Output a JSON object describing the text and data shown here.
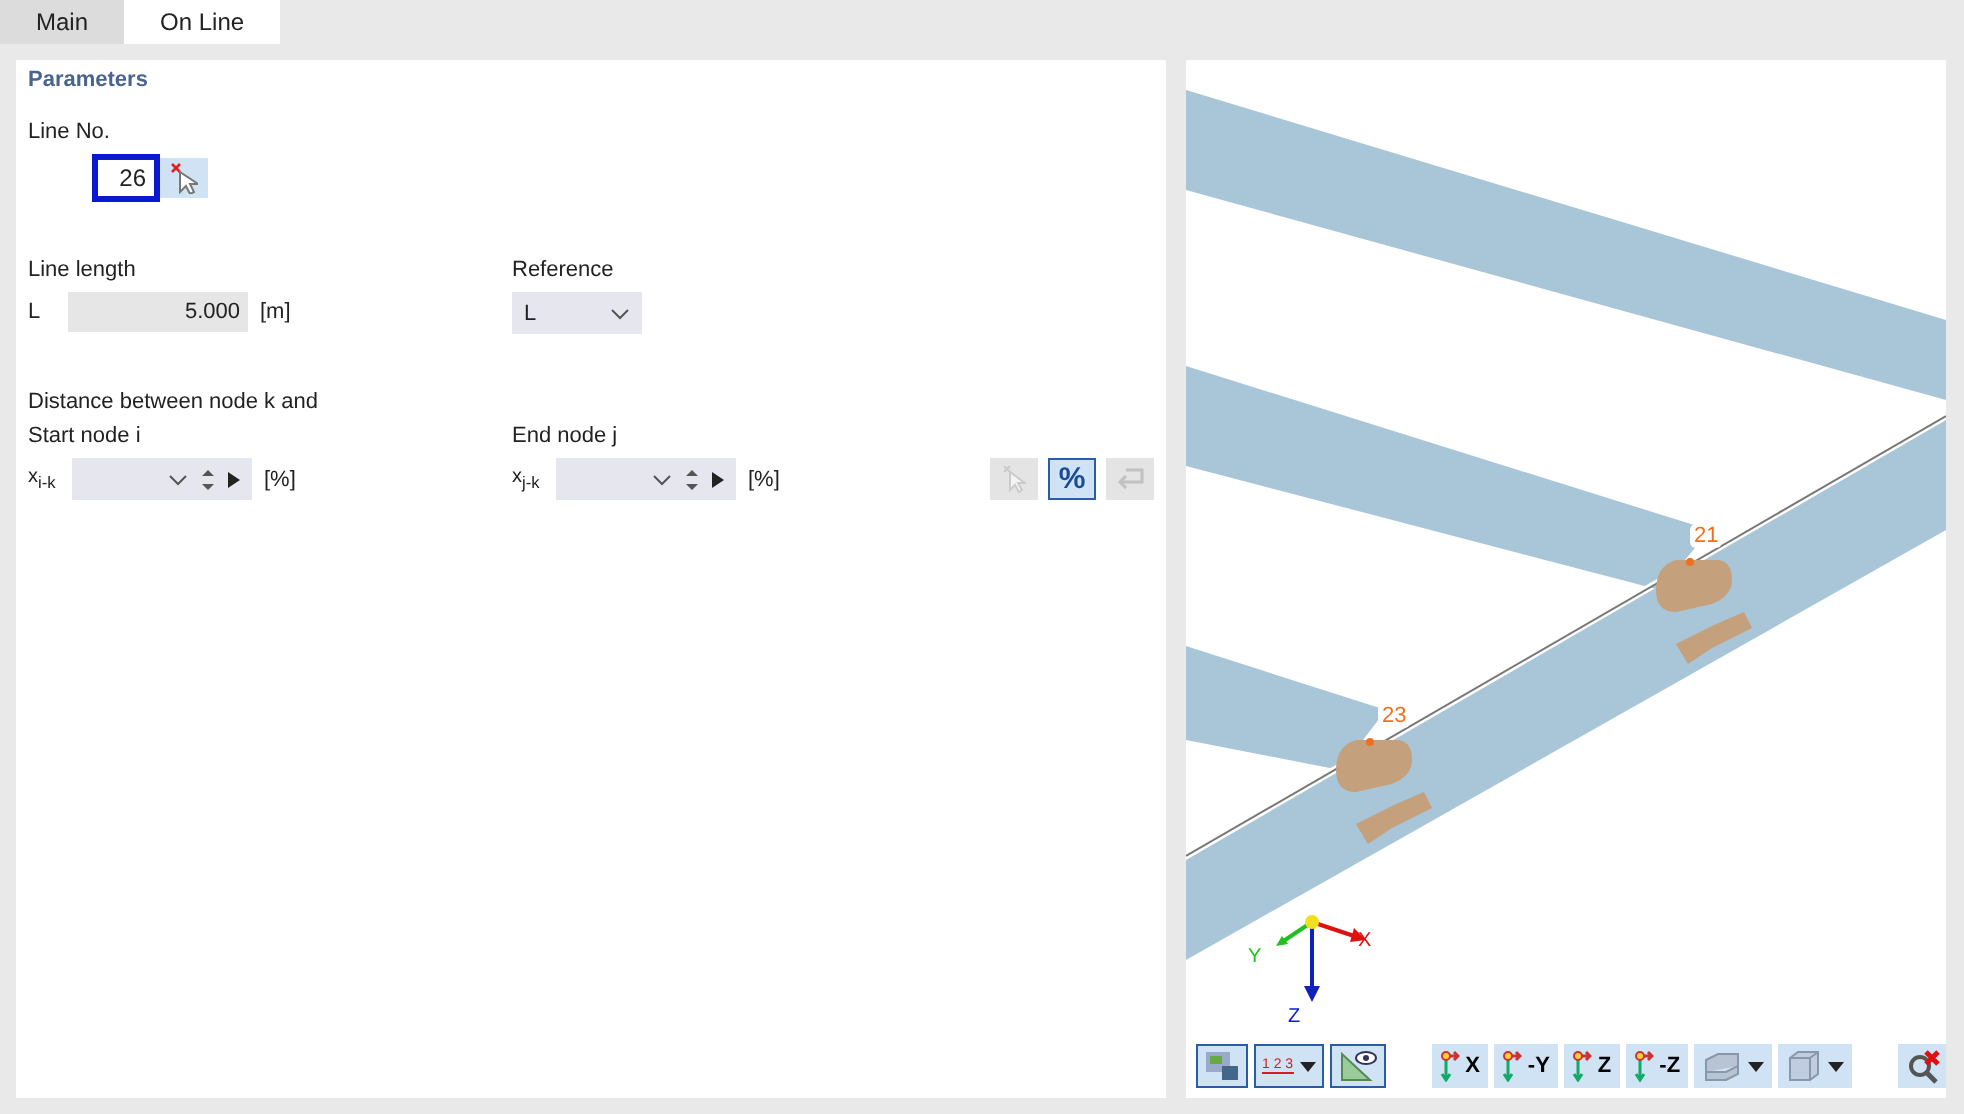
{
  "tabs": [
    {
      "label": "Main",
      "selected": false
    },
    {
      "label": "On Line",
      "selected": true
    }
  ],
  "parameters": {
    "title": "Parameters",
    "line_no": {
      "label": "Line No.",
      "value": "26",
      "focused": true
    },
    "line_length": {
      "label": "Line length",
      "symbol": "L",
      "value": "5.000",
      "unit": "[m]"
    },
    "reference": {
      "label": "Reference",
      "value": "L"
    },
    "distance": {
      "heading": "Distance between node k and",
      "start": {
        "label": "Start node i",
        "symbol": "x$_{i-k}$",
        "unit": "[%]"
      },
      "end": {
        "label": "End node j",
        "symbol": "x$_{j-k}$",
        "unit": "[%]"
      }
    },
    "tools": [
      {
        "kind": "pick",
        "disabled": true,
        "selected": false
      },
      {
        "kind": "percent",
        "label": "%",
        "disabled": false,
        "selected": true
      },
      {
        "kind": "undo",
        "disabled": true,
        "selected": false
      }
    ]
  },
  "view": {
    "node_labels": [
      "21",
      "23"
    ],
    "axes": {
      "x": "X",
      "y": "Y",
      "z": "Z"
    },
    "toolbar": [
      {
        "kind": "render",
        "selected": true
      },
      {
        "kind": "dimension",
        "label": "1 2 3",
        "selected": true,
        "dropdown": true
      },
      {
        "kind": "visibility",
        "selected": true
      },
      {
        "kind": "view",
        "label": "X",
        "selected": false
      },
      {
        "kind": "view",
        "label": "-Y",
        "selected": false
      },
      {
        "kind": "view",
        "label": "Z",
        "selected": false
      },
      {
        "kind": "view",
        "label": "-Z",
        "selected": false
      },
      {
        "kind": "iso",
        "selected": false,
        "dropdown": true
      },
      {
        "kind": "box",
        "selected": false,
        "dropdown": true
      },
      {
        "kind": "zoom-reset",
        "selected": false
      }
    ]
  }
}
